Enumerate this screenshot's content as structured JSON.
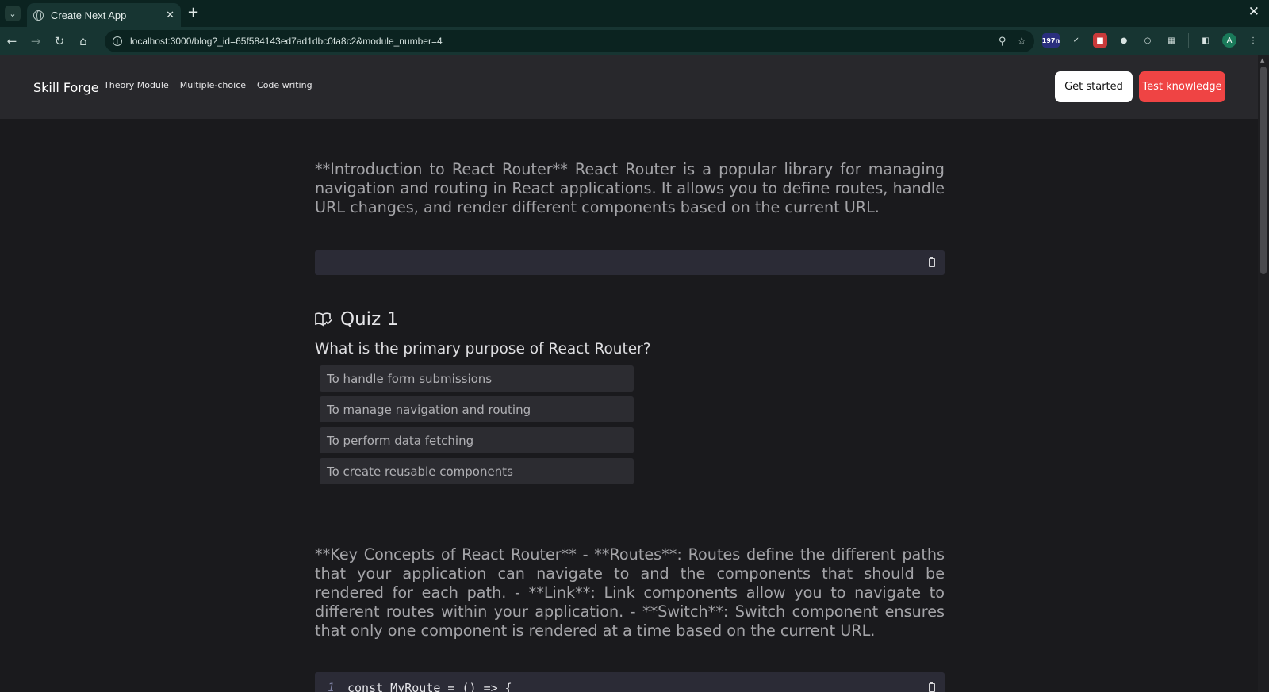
{
  "browser": {
    "tab_title": "Create Next App",
    "url": "localhost:3000/blog?_id=65f584143ed7ad1dbc0fa8c2&module_number=4",
    "extension_badge": "197n",
    "profile_initial": "A"
  },
  "header": {
    "brand": "Skill Forge",
    "nav": [
      "Theory Module",
      "Multiple-choice",
      "Code writing"
    ],
    "get_started": "Get started",
    "test_knowledge": "Test knowledge"
  },
  "sections": {
    "intro": "**Introduction to React Router** React Router is a popular library for managing navigation and routing in React applications. It allows you to define routes, handle URL changes, and render different components based on the current URL.",
    "quiz": {
      "title": "Quiz 1",
      "question": "What is the primary purpose of React Router?",
      "options": [
        "To handle form submissions",
        "To manage navigation and routing",
        "To perform data fetching",
        "To create reusable components"
      ]
    },
    "concepts": "**Key Concepts of React Router** - **Routes**: Routes define the different paths that your application can navigate to and the components that should be rendered for each path. - **Link**: Link components allow you to navigate to different routes within your application. - **Switch**: Switch component ensures that only one component is rendered at a time based on the current URL.",
    "code": {
      "line_number": "1",
      "line": "const MyRoute = () => {"
    }
  },
  "colors": {
    "accent_red": "#ef4444",
    "page_bg": "#1a1a1d",
    "header_bg": "#28282c"
  }
}
